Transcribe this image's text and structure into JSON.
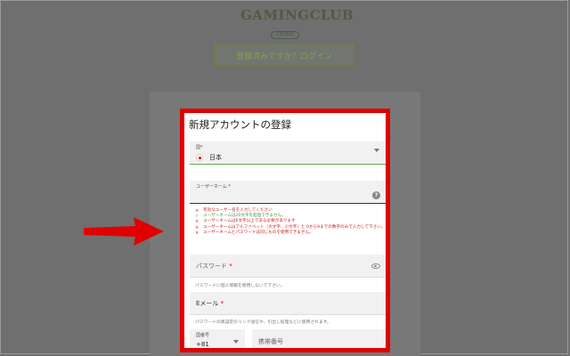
{
  "logo": {
    "main": "GAMINGCLUB",
    "sub": "CASINO"
  },
  "login_button": "登録済みですか？ログイン",
  "form": {
    "title": "新規アカウントの登録",
    "country": {
      "label": "国",
      "required": "*",
      "value": "日本"
    },
    "username": {
      "label": "ユーザーネーム",
      "required": "*",
      "help": "?"
    },
    "rules": [
      {
        "status": "error",
        "mark": "×",
        "text": "有効なユーザー名を入力してください"
      },
      {
        "status": "ok",
        "mark": "✓",
        "text": "ユーザーネームは20文字を超過できません。"
      },
      {
        "status": "error",
        "mark": "×",
        "text": "ユーザーネームは6文字以上である必要があります"
      },
      {
        "status": "error",
        "mark": "×",
        "text": "ユーザーネームはアルファベット（大文字、小文字）と 0から9までの数字のみで入力して下さい。"
      },
      {
        "status": "error",
        "mark": "×",
        "text": "ユーザーネームとパスワードは同じものを使用できません。"
      }
    ],
    "password": {
      "label": "パスワード",
      "required": "*",
      "hint": "パスワードに個人情報を使用しないで下さい。"
    },
    "email": {
      "label": "Eメール",
      "required": "*",
      "hint": "パスワードの再設定のリンク送信や、引出し処理などに使用されます。"
    },
    "phone_code": {
      "label": "国番号",
      "value": "+81"
    },
    "phone": {
      "placeholder": "携帯番号"
    }
  },
  "colors": {
    "highlight": "#e00000",
    "error": "#cc2222",
    "ok": "#3c9a3c",
    "accent": "#6aa84f"
  },
  "icons": [
    "chevron-down-icon",
    "help-icon",
    "eye-icon",
    "arrow-icon",
    "flag-icon"
  ]
}
